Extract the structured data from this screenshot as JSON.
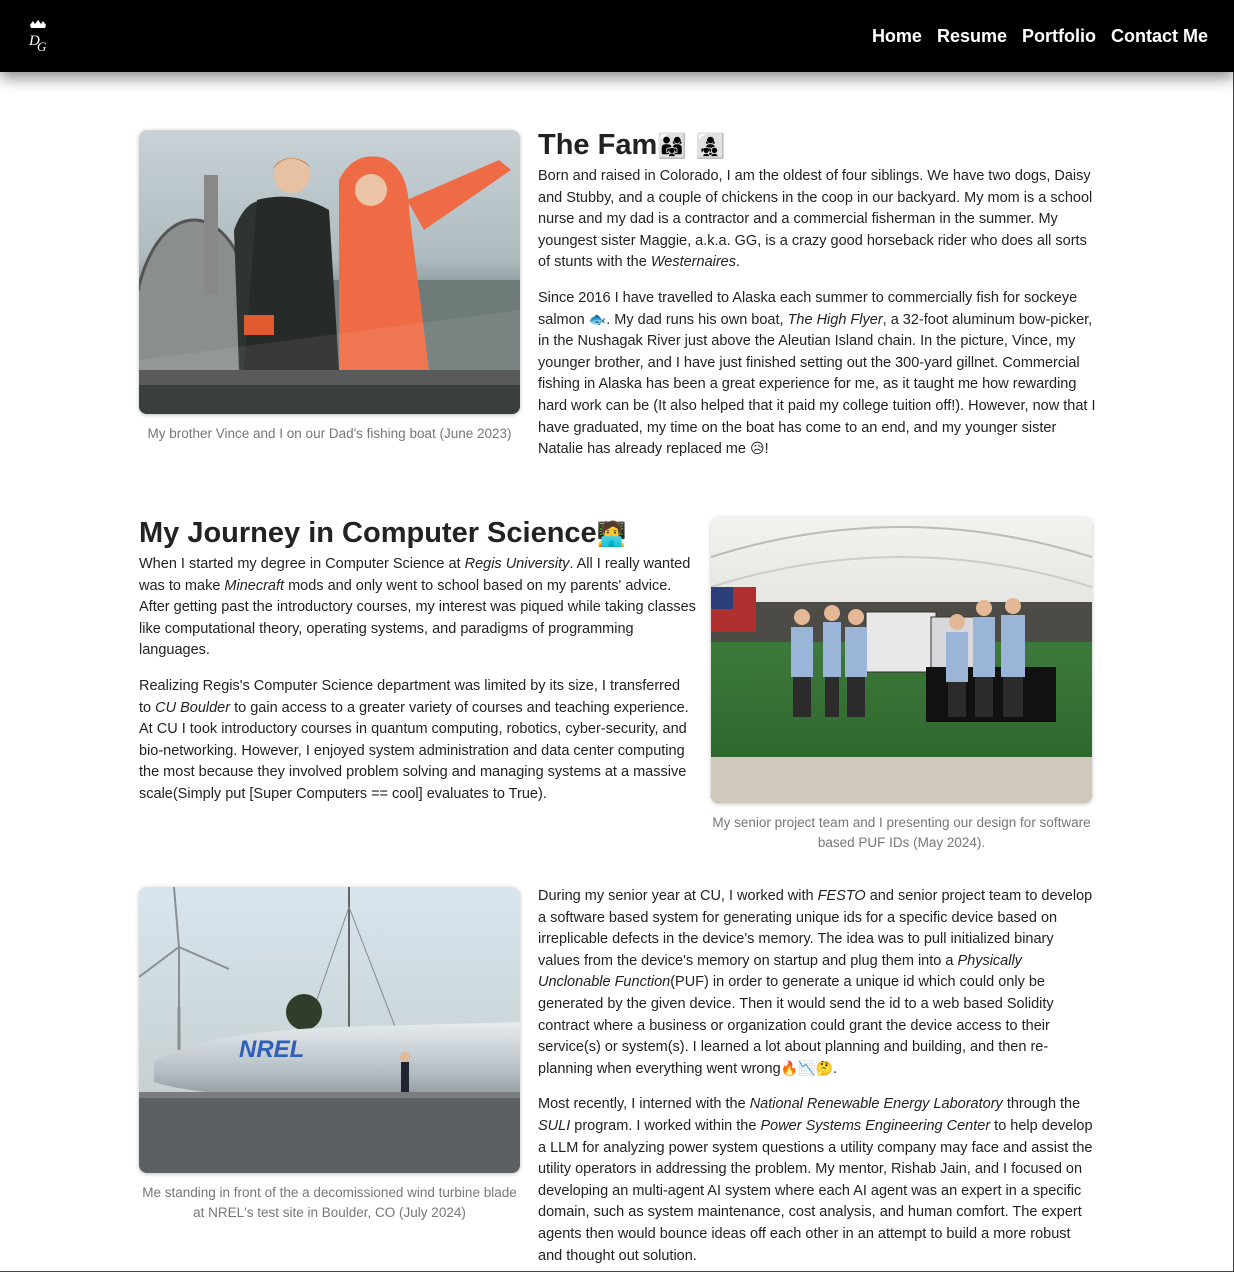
{
  "nav": {
    "logo_alt": "DG",
    "links": [
      "Home",
      "Resume",
      "Portfolio",
      "Contact Me"
    ]
  },
  "fam": {
    "title": "The Fam",
    "title_emoji": "👨‍👩‍👧 👩‍👧‍👦",
    "p1_a": "Born and raised in Colorado, I am the oldest of four siblings. We have two dogs, Daisy and Stubby, and a couple of chickens in the coop in our backyard. My mom is a school nurse and my dad is a contractor and a commercial fisherman in the summer. My youngest sister Maggie, a.k.a. GG, is a crazy good horseback rider who does all sorts of stunts with the ",
    "p1_em": "Westernaires",
    "p1_b": ".",
    "p2_a": "Since 2016 I have travelled to Alaska each summer to commercially fish for sockeye salmon ",
    "p2_fish": "🐟",
    "p2_b": ". My dad runs his own boat, ",
    "p2_em": "The High Flyer",
    "p2_c": ", a 32-foot aluminum bow-picker, in the Nushagak River just above the Aleutian Island chain. In the picture, Vince, my younger brother, and I have just finished setting out the 300-yard gillnet. Commercial fishing in Alaska has been a great experience for me, as it taught me how rewarding hard work can be (It also helped that it paid my college tuition off!). However, now that I have graduated, my time on the boat has come to an end, and my younger sister Natalie has already replaced me ",
    "p2_sad": "😥",
    "p2_d": "!",
    "caption": "My brother Vince and I on our Dad's fishing boat (June 2023)"
  },
  "journey": {
    "title": "My Journey in Computer Science",
    "title_emoji": "🧑‍💻",
    "p1_a": "When I started my degree in Computer Science at ",
    "p1_em1": "Regis University",
    "p1_b": ". All I really wanted was to make ",
    "p1_em2": "Minecraft",
    "p1_c": " mods and only went to school based on my parents' advice. After getting past the introductory courses, my interest was piqued while taking classes like computational theory, operating systems, and paradigms of programming languages.",
    "p2_a": "Realizing Regis's Computer Science department was limited by its size, I transferred to ",
    "p2_em": "CU Boulder",
    "p2_b": " to gain access to a greater variety of courses and teaching experience. At CU I took introductory courses in quantum computing, robotics, cyber-security, and bio-networking. However, I enjoyed system administration and data center computing the most because they involved problem solving and managing systems at a massive scale(Simply put [Super Computers == cool] evaluates to True).",
    "caption": "My senior project team and I presenting our design for software based PUF IDs (May 2024)."
  },
  "nrel": {
    "p1_a": "During my senior year at CU, I worked with ",
    "p1_em1": "FESTO",
    "p1_b": " and senior project team to develop a software based system for generating unique ids for a specific device based on irreplicable defects in the device's memory. The idea was to pull initialized binary values from the device's memory on startup and plug them into a ",
    "p1_em2": "Physically Unclonable Function",
    "p1_c": "(PUF) in order to generate a unique id which could only be generated by the given device. Then it would send the id to a web based Solidity contract where a business or organization could grant the device access to their service(s) or system(s). I learned a lot about planning and building, and then re-planning when everything went wrong",
    "p1_emoji": "🔥📉🤔",
    "p1_d": ".",
    "p2_a": "Most recently, I interned with the ",
    "p2_em1": "National Renewable Energy Laboratory",
    "p2_b": " through the ",
    "p2_em2": "SULI",
    "p2_c": " program. I worked within the ",
    "p2_em3": "Power Systems Engineering Center",
    "p2_d": " to help develop a LLM for analyzing power system questions a utility company may face and assist the utility operators in addressing the problem. My mentor, Rishab Jain, and I focused on developing an multi-agent AI system where each AI agent was an expert in a specific domain, such as system maintenance, cost analysis, and human comfort. The expert agents then would bounce ideas off each other in an attempt to build a more robust and thought out solution.",
    "photo_text": "NREL",
    "caption": "Me standing in front of the a decomissioned wind turbine blade at NREL's test site in Boulder, CO (July 2024)"
  }
}
